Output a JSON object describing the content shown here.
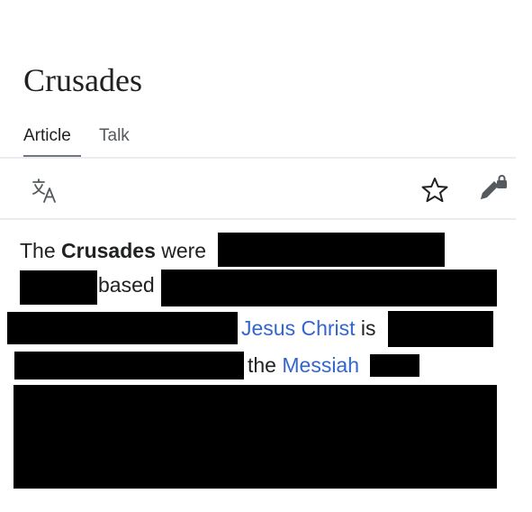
{
  "article": {
    "title": "Crusades"
  },
  "tabs": [
    {
      "label": "Article",
      "selected": true
    },
    {
      "label": "Talk",
      "selected": false
    }
  ],
  "toolbar": {
    "icons": [
      "language-icon",
      "star-icon",
      "edit-lock-icon"
    ]
  },
  "body": {
    "line1": {
      "prefix": "The ",
      "bold": "Crusades",
      "suffix": " were"
    },
    "line2": {
      "text": "based"
    },
    "line3": {
      "link": "Jesus Christ",
      "suffix": " is"
    },
    "line4": {
      "prefix": "the ",
      "link": "Messiah"
    }
  },
  "colors": {
    "link": "#3366cc",
    "text": "#202122",
    "divider": "#eaecf0",
    "redaction": "#000000"
  }
}
